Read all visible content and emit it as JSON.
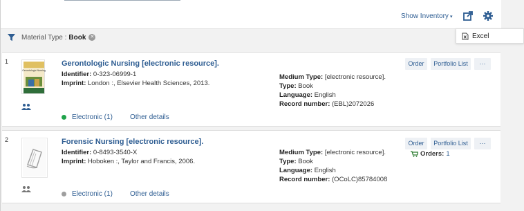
{
  "toolbar": {
    "show_inventory": "Show Inventory",
    "export_menu_item": "Excel"
  },
  "filter": {
    "label": "Material Type :",
    "value": "Book"
  },
  "results": [
    {
      "number": "1",
      "title": "Gerontologic Nursing [electronic resource].",
      "identifier_label": "Identifier:",
      "identifier": "0-323-06999-1",
      "imprint_label": "Imprint:",
      "imprint": "London :, Elsevier Health Sciences, 2013.",
      "medium_label": "Medium Type:",
      "medium": "[electronic resource].",
      "type_label": "Type:",
      "type": "Book",
      "language_label": "Language:",
      "language": "English",
      "record_label": "Record number:",
      "record": "(EBL)2072026",
      "availability": "Electronic (1)",
      "availability_color": "#1fa34a",
      "other_details": "Other details",
      "buttons": [
        "Order",
        "Portfolio List",
        "···"
      ],
      "thumbnail_title": "Gerontologic Nursing"
    },
    {
      "number": "2",
      "title": "Forensic Nursing [electronic resource].",
      "identifier_label": "Identifier:",
      "identifier": "0-8493-3540-X",
      "imprint_label": "Imprint:",
      "imprint": "Hoboken :, Taylor and Francis, 2006.",
      "medium_label": "Medium Type:",
      "medium": "[electronic resource].",
      "type_label": "Type:",
      "type": "Book",
      "language_label": "Language:",
      "language": "English",
      "record_label": "Record number:",
      "record": "(OCoLC)85784008",
      "availability": "Electronic (1)",
      "availability_color": "#9e9e9e",
      "other_details": "Other details",
      "buttons": [
        "Order",
        "Portfolio List",
        "···"
      ],
      "orders_label": "Orders:",
      "orders_value": "1"
    }
  ]
}
